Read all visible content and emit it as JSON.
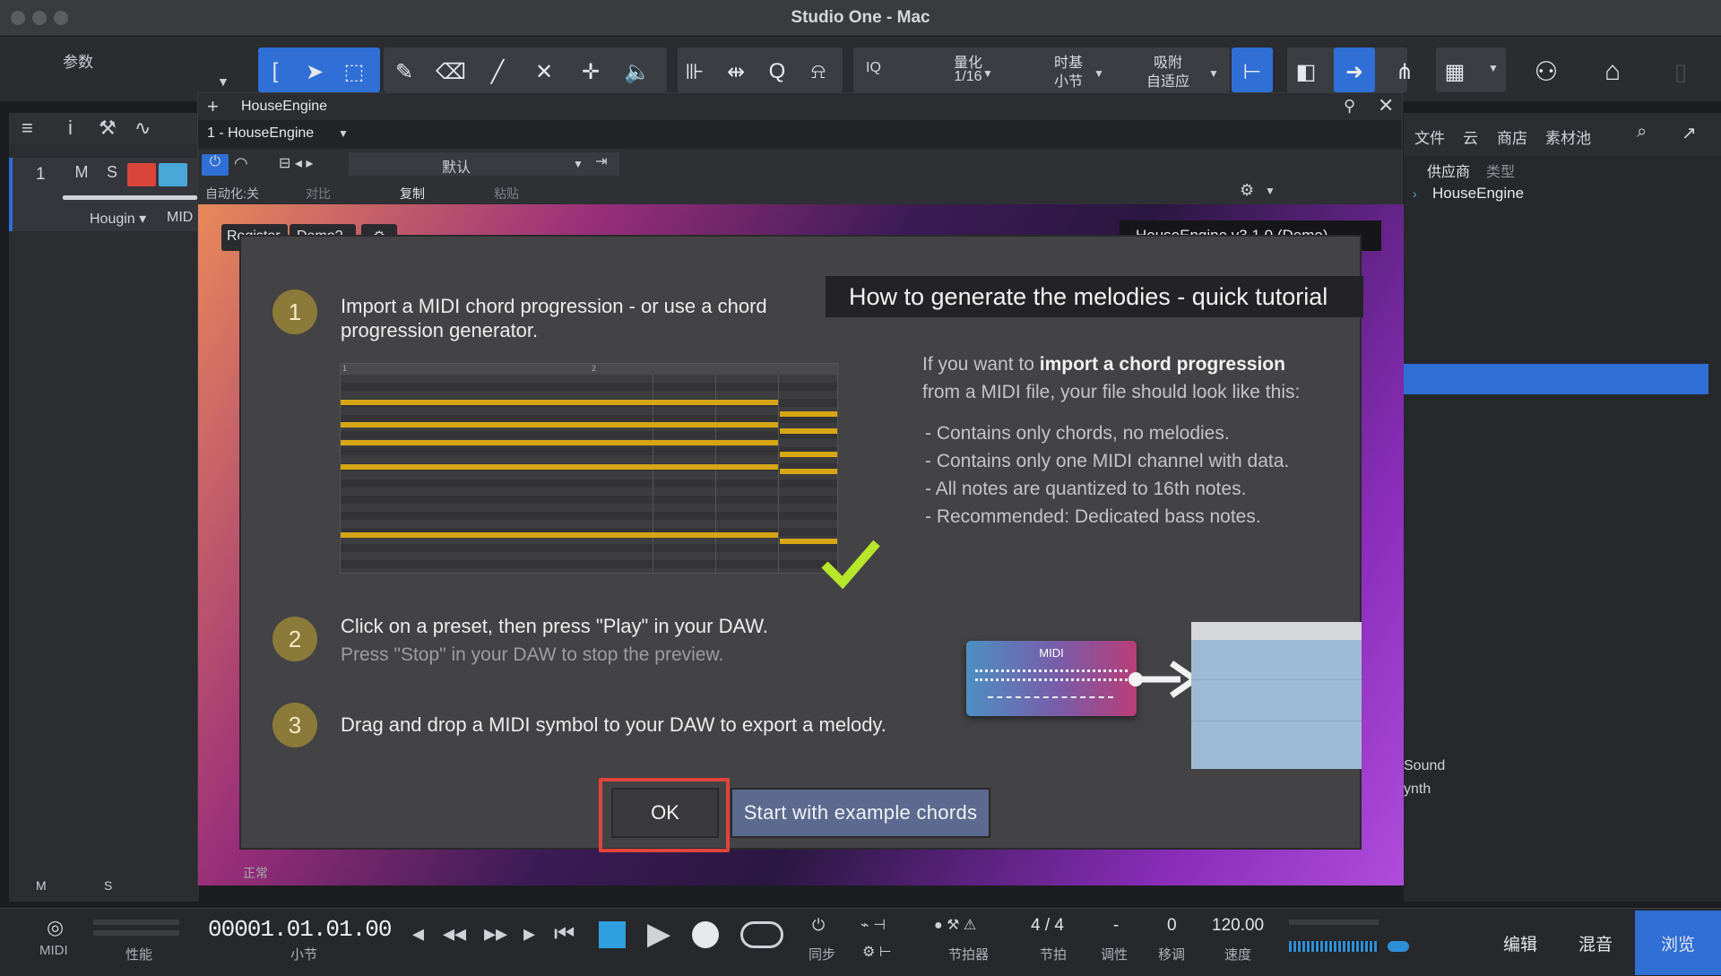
{
  "window": {
    "title": "Studio One - Mac"
  },
  "toolbar": {
    "params_label": "参数",
    "quantize_label": "量化",
    "quantize_value": "1/16",
    "timebase_label": "时基",
    "timebase_value": "小节",
    "snap_label": "吸附",
    "snap_value": "自适应",
    "iq_label": "IQ"
  },
  "track": {
    "number": "1",
    "mute": "M",
    "solo": "S",
    "instrument": "Hougin ▾",
    "midi": "MIDI"
  },
  "plugin": {
    "title": "HouseEngine",
    "instance": "1 - HouseEngine",
    "preset": "默认",
    "auto": "自动化:关",
    "compare": "对比",
    "copy": "复制",
    "paste": "粘贴",
    "tab_register": "Register",
    "tab_demo": "Demo?",
    "version": "HouseEngine v3.1.0 (Demo)",
    "bottom_status": "正常"
  },
  "browser": {
    "tabs": [
      "文件",
      "云",
      "商店",
      "素材池"
    ],
    "col_vendor": "供应商",
    "col_type": "类型",
    "item": "HouseEngine",
    "frag1": "Sound",
    "frag2": "ynth"
  },
  "modal": {
    "title": "How to generate the melodies - quick tutorial",
    "step1_num": "1",
    "step1_line1": "Import a MIDI chord progression - or use a chord",
    "step1_line2": "progression generator.",
    "step2_num": "2",
    "step2_main": "Click on a preset, then press \"Play\" in your DAW.",
    "step2_sub": "Press \"Stop\" in your DAW to stop the preview.",
    "step3_num": "3",
    "step3_main": "Drag and drop a MIDI symbol to your DAW to export a melody.",
    "info_prefix": "If you want to ",
    "info_bold": "import a chord progression",
    "info_line2": "from a MIDI file, your file should look like this:",
    "bullets": [
      "- Contains only chords, no melodies.",
      "- Contains only one MIDI channel with data.",
      "- All notes are quantized to 16th notes.",
      "- Recommended: Dedicated bass notes."
    ],
    "piano_marker_1": "1",
    "piano_marker_2": "2",
    "midi_label": "MIDI",
    "ok_label": "OK",
    "example_label": "Start with example chords"
  },
  "transport": {
    "midi": "MIDI",
    "perf": "性能",
    "position": "00001.01.01.00",
    "position_unit": "小节",
    "sync": "同步",
    "metronome": "节拍器",
    "signature": "4 / 4",
    "signature_label": "节拍",
    "key": "-",
    "key_label": "调性",
    "transpose": "0",
    "transpose_label": "移调",
    "tempo": "120.00",
    "tempo_label": "速度",
    "left_m": "M",
    "left_s": "S"
  },
  "bottom_tabs": [
    "编辑",
    "混音",
    "浏览"
  ],
  "colors": {
    "accent": "#2f6fd6",
    "highlight": "#e0443c",
    "note": "#d7a614",
    "check": "#b8e62a"
  }
}
